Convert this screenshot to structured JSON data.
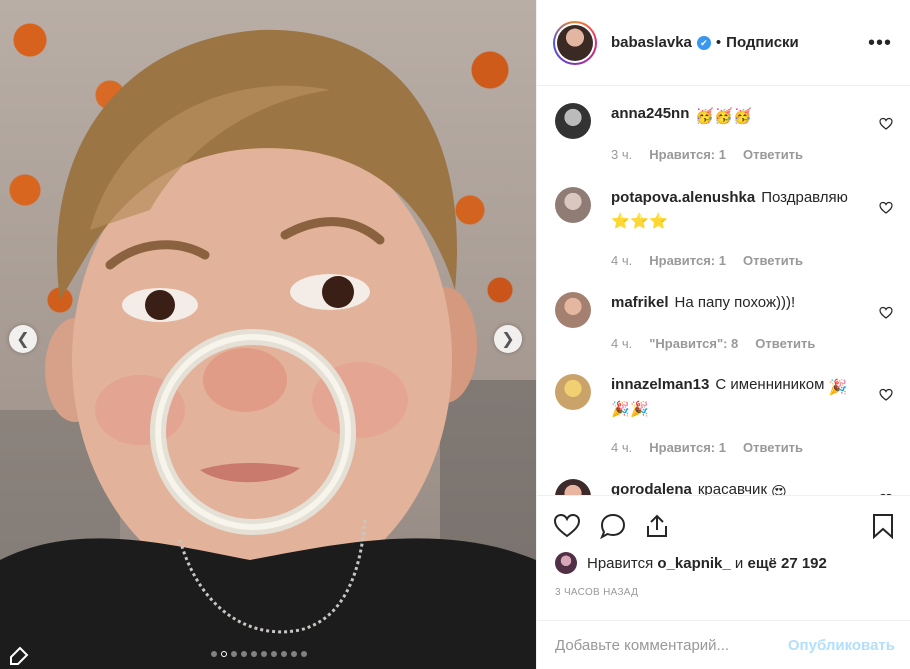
{
  "post": {
    "owner": "babaslavka",
    "separator": "•",
    "follow_label": "Подписки",
    "more_icon": "more-icon"
  },
  "carousel": {
    "prev_icon": "chevron-left-icon",
    "next_icon": "chevron-right-icon",
    "total_slides": 10,
    "active_slide": 2
  },
  "comments": [
    {
      "user": "anna245nn",
      "text": "",
      "emoji": [
        "🥳",
        "🥳",
        "🥳"
      ],
      "time": "3 ч.",
      "likes": "Нравится: 1",
      "reply": "Ответить"
    },
    {
      "user": "potapova.alenushka",
      "text": "Поздравляю",
      "emoji": [
        "⭐",
        "⭐",
        "⭐"
      ],
      "time": "4 ч.",
      "likes": "Нравится: 1",
      "reply": "Ответить"
    },
    {
      "user": "mafrikel",
      "text": "На папу похож)))!",
      "emoji": [],
      "time": "4 ч.",
      "likes": "\"Нравится\": 8",
      "reply": "Ответить"
    },
    {
      "user": "innazelman13",
      "text": "С именниником",
      "emoji": [
        "🎉",
        "🎉",
        "🎉"
      ],
      "time": "4 ч.",
      "likes": "Нравится: 1",
      "reply": "Ответить"
    },
    {
      "user": "gorodalena",
      "text": "красавчик",
      "emoji": [
        "😍"
      ],
      "time": "",
      "likes": "",
      "reply": ""
    }
  ],
  "likes": {
    "prefix": "Нравится",
    "user": "o_kapnik_",
    "and": "и",
    "others": "ещё 27 192"
  },
  "time_ago": "3 ЧАСОВ НАЗАД",
  "add_comment": {
    "placeholder": "Добавьте комментарий...",
    "publish_label": "Опубликовать"
  },
  "colors": {
    "publish_disabled": "#b2dffc",
    "verified": "#3897f0",
    "meta_gray": "#999999"
  }
}
